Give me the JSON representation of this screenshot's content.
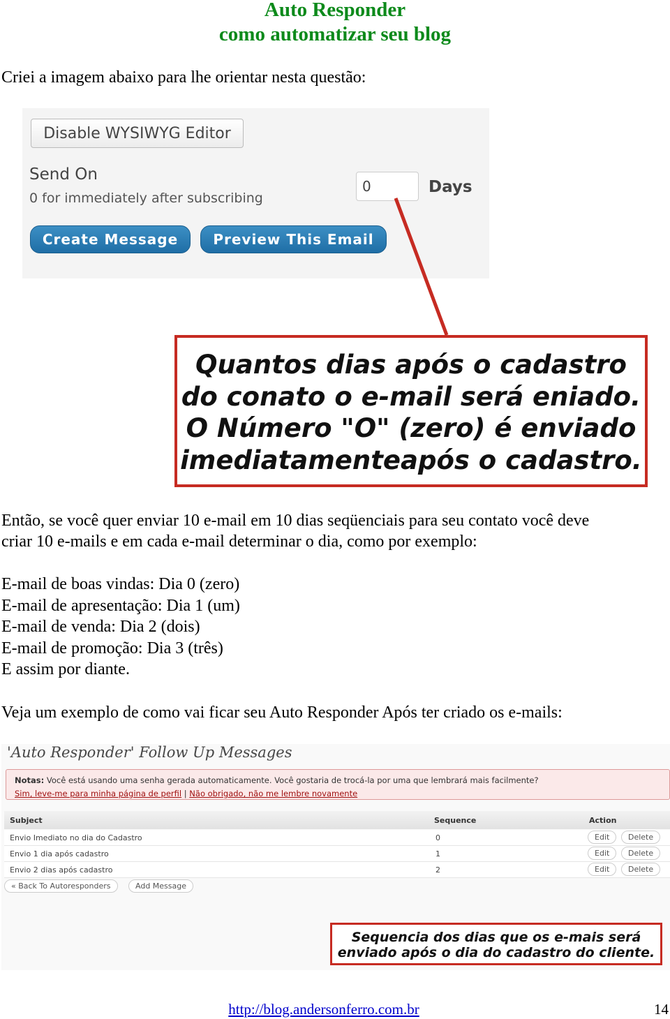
{
  "header": {
    "title_line1": "Auto Responder",
    "title_line2": "como automatizar seu blog"
  },
  "intro": "Criei a imagem abaixo para lhe orientar nesta questão:",
  "screenshot1": {
    "disable_button": "Disable WYSIWYG Editor",
    "send_on_label": "Send On",
    "send_on_hint": "0 for immediately after subscribing",
    "days_value": "0",
    "days_label": "Days",
    "create_button": "Create Message",
    "preview_button": "Preview This Email"
  },
  "callout1": [
    "Quantos dias após o cadastro",
    "do conato o e-mail será eniado.",
    "O Número \"O\" (zero) é enviado",
    "imediatamenteapós o cadastro."
  ],
  "paragraph": [
    "Então, se você quer enviar 10 e-mail em 10 dias seqüenciais para seu contato você deve",
    "criar 10 e-mails e em cada e-mail determinar o dia, como por exemplo:"
  ],
  "examples": [
    "E-mail de boas vindas: Dia 0 (zero)",
    "E-mail de apresentação: Dia 1 (um)",
    "E-mail de venda: Dia 2 (dois)",
    "E-mail de promoção: Dia 3 (três)",
    "E assim por diante."
  ],
  "veja": "Veja um exemplo de como vai ficar seu Auto Responder Após ter criado os e-mails:",
  "screenshot2": {
    "heading": "'Auto Responder' Follow Up Messages",
    "notice_label": "Notas:",
    "notice_text": " Você está usando uma senha gerada automaticamente. Você gostaria de trocá-la por uma que lembrará mais facilmente?",
    "notice_link1": "Sim, leve-me para minha página de perfil",
    "notice_sep": " | ",
    "notice_link2": "Não obrigado, não me lembre novamente",
    "columns": [
      "Subject",
      "Sequence",
      "Action"
    ],
    "rows": [
      {
        "subject": "Envio Imediato no dia do Cadastro",
        "sequence": "0",
        "edit": "Edit",
        "delete": "Delete"
      },
      {
        "subject": "Envio 1 dia após cadastro",
        "sequence": "1",
        "edit": "Edit",
        "delete": "Delete"
      },
      {
        "subject": "Envio 2 dias após cadastro",
        "sequence": "2",
        "edit": "Edit",
        "delete": "Delete"
      }
    ],
    "back_button": "« Back To Autoresponders",
    "add_button": "Add Message"
  },
  "callout2": [
    "Sequencia dos dias que os e-mais será",
    "enviado após o dia do cadastro do cliente."
  ],
  "footer": {
    "link": "http://blog.andersonferro.com.br",
    "page_number": "14"
  },
  "colors": {
    "title": "#0d8a1b",
    "callout_border": "#c62b22",
    "button_blue": "#2a7db8"
  }
}
